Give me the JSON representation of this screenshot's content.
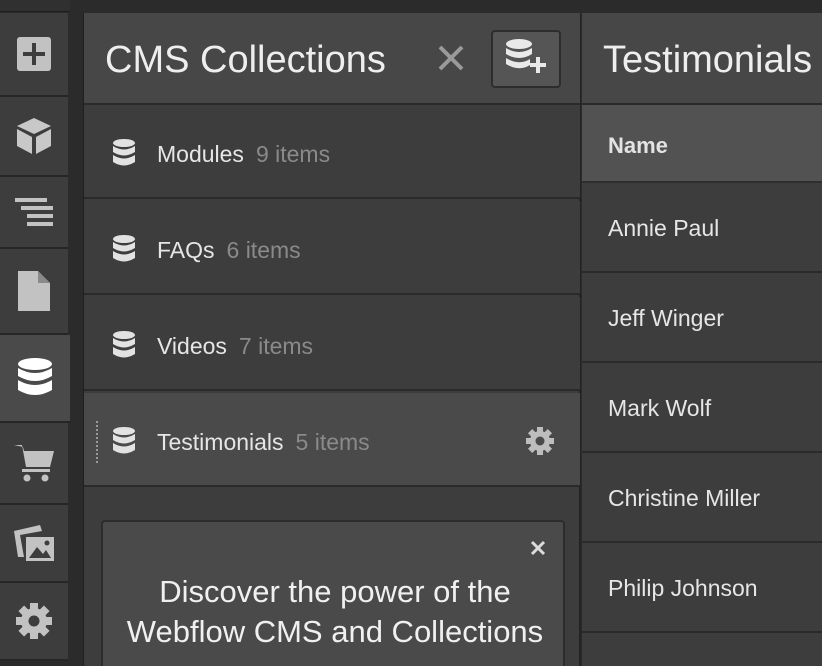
{
  "rail": {
    "items": [
      {
        "icon": "add-panel-icon"
      },
      {
        "icon": "symbols-cube-icon"
      },
      {
        "icon": "navigator-icon"
      },
      {
        "icon": "pages-icon"
      },
      {
        "icon": "cms-database-icon",
        "active": true
      },
      {
        "icon": "ecommerce-cart-icon"
      },
      {
        "icon": "assets-images-icon"
      },
      {
        "icon": "settings-gear-icon"
      }
    ]
  },
  "collections_panel": {
    "title": "CMS Collections",
    "collections": [
      {
        "name": "Modules",
        "count": "9 items"
      },
      {
        "name": "FAQs",
        "count": "6 items"
      },
      {
        "name": "Videos",
        "count": "7 items"
      },
      {
        "name": "Testimonials",
        "count": "5 items",
        "selected": true
      }
    ],
    "promo": {
      "text": "Discover the power of the Webflow CMS and Collections"
    }
  },
  "items_table": {
    "title": "Testimonials",
    "column_header": "Name",
    "rows": [
      "Annie Paul",
      "Jeff Winger",
      "Mark Wolf",
      "Christine Miller",
      "Philip Johnson"
    ]
  },
  "colors": {
    "background": "#2b2b2b",
    "panel": "#3d3d3d",
    "header": "#474747",
    "selected": "#4a4a4a",
    "muted_text": "#8a8a8a"
  }
}
